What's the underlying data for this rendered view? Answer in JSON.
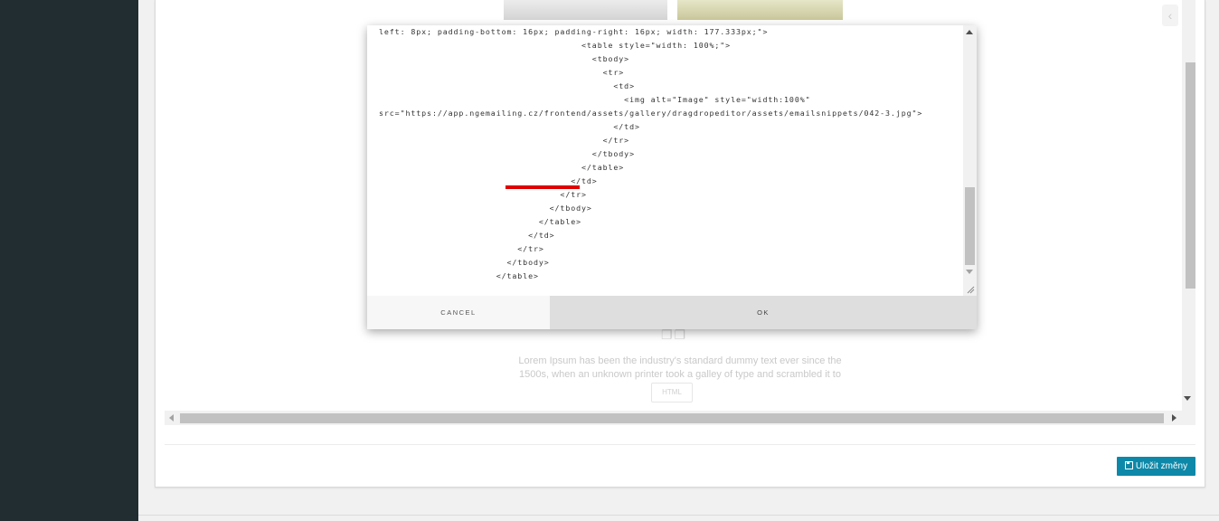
{
  "code_lines": [
    "left: 8px; padding-bottom: 16px; padding-right: 16px; width: 177.333px;\">",
    "                                      <table style=\"width: 100%;\">",
    "                                        <tbody>",
    "                                          <tr>",
    "                                            <td>",
    "                                              <img alt=\"Image\" style=\"width:100%\"",
    "src=\"https://app.ngemailing.cz/frontend/assets/gallery/dragdropeditor/assets/emailsnippets/042-3.jpg\">",
    "                                            </td>",
    "                                          </tr>",
    "                                        </tbody>",
    "                                      </table>",
    "                                    </td>",
    "                                  </tr>",
    "                                </tbody>",
    "                              </table>",
    "                            </td>",
    "                          </tr>",
    "                        </tbody>",
    "                      </table>"
  ],
  "dialog": {
    "cancel_label": "CANCEL",
    "ok_label": "OK"
  },
  "background": {
    "ghost_text": "Lorem Ipsum has been the industry's standard dummy text ever since the 1500s, when an unknown printer took a galley of type and scrambled it to make",
    "ghost_button": "HTML",
    "ghost_icon": "❐❐"
  },
  "footer": {
    "save_label": "Uložit změny"
  },
  "colors": {
    "sidebar": "#222d32",
    "save_button": "#0e88a8",
    "highlight": "#e00000"
  }
}
